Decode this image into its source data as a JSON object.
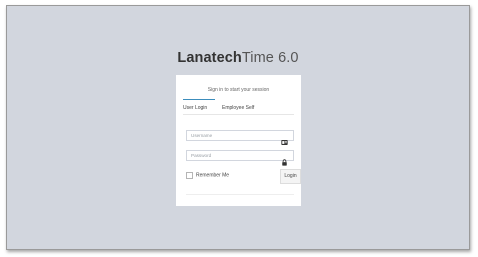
{
  "logo": {
    "brand": "Lanatech",
    "product": "Time 6.0"
  },
  "login": {
    "message": "Sign in to start your session",
    "tabs": [
      {
        "label": "User Login",
        "active": true
      },
      {
        "label": "Employee Self",
        "active": false
      }
    ],
    "username": {
      "placeholder": "Username",
      "value": "",
      "icon": "id-card-icon"
    },
    "password": {
      "placeholder": "Password",
      "value": "",
      "icon": "lock-icon"
    },
    "remember_label": "Remember Me",
    "remember_checked": false,
    "login_label": "Login"
  },
  "colors": {
    "background": "#d2d6de",
    "card": "#ffffff",
    "accent": "#3c8dbc"
  }
}
